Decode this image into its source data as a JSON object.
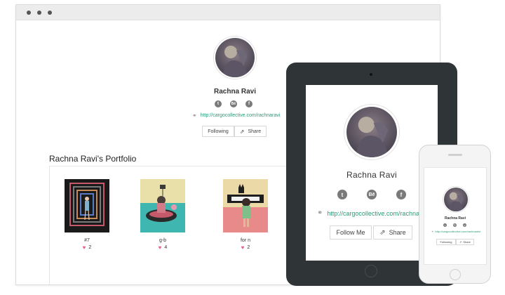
{
  "profile": {
    "name": "Rachna Ravi",
    "url": "http://cargocollective.com/rachnaravi",
    "social": [
      {
        "icon": "tumblr-icon",
        "glyph": "t"
      },
      {
        "icon": "behance-icon",
        "glyph": "Bē"
      },
      {
        "icon": "facebook-icon",
        "glyph": "f"
      }
    ]
  },
  "desktop": {
    "follow_label": "Following",
    "share_label": "Share",
    "portfolio_title": "Rachna Ravi's Portfolio",
    "items": [
      {
        "label": "#7",
        "likes": "2"
      },
      {
        "label": "g-b",
        "likes": "4"
      },
      {
        "label": "for n",
        "likes": "2"
      }
    ]
  },
  "tablet": {
    "url_display": "http://cargocollective.com/rachnaravi",
    "follow_label": "Follow Me",
    "share_label": "Share"
  },
  "phone": {
    "url_display": "http://cargocollective.com/rachnaravi",
    "follow_label": "Following",
    "share_label": "Share"
  },
  "colors": {
    "link": "#2a9a7a",
    "heart": "#e8608a",
    "tablet_frame": "#2f3537"
  }
}
